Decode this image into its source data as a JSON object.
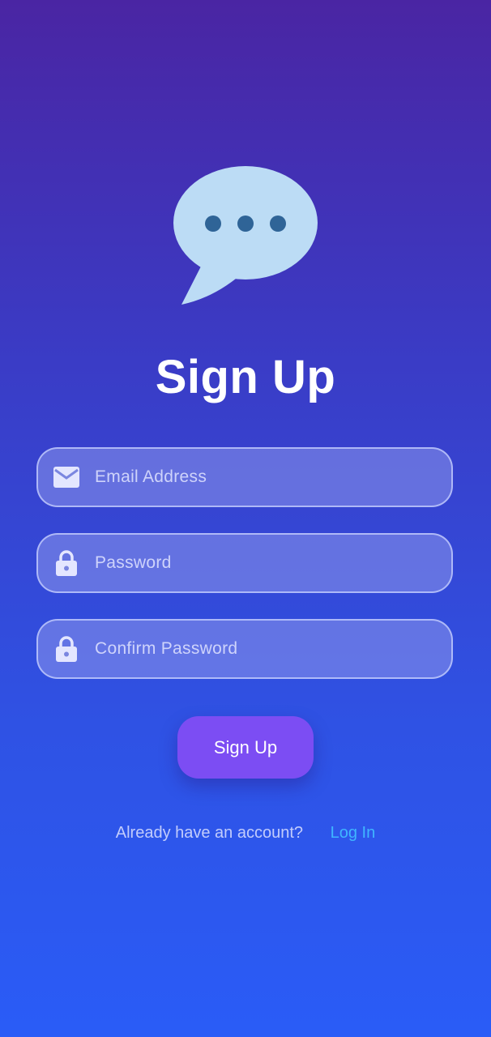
{
  "page": {
    "title": "Sign Up"
  },
  "form": {
    "email": {
      "placeholder": "Email Address",
      "value": "",
      "icon": "mail-icon"
    },
    "password": {
      "placeholder": "Password",
      "value": "",
      "icon": "lock-icon"
    },
    "confirm_password": {
      "placeholder": "Confirm Password",
      "value": "",
      "icon": "lock-icon"
    },
    "submit_label": "Sign Up"
  },
  "footer": {
    "prompt": "Already have an account?",
    "login_label": "Log In"
  },
  "colors": {
    "button": "#7c4df3",
    "link": "#3fb6ff",
    "bubble": "#bcdcf5",
    "bubble_dots": "#2f6497"
  }
}
